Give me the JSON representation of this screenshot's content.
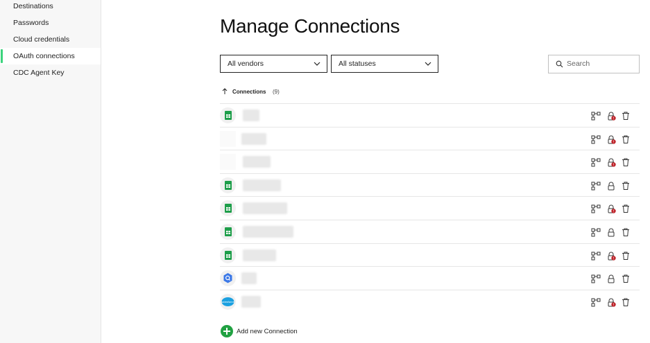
{
  "sidebar": {
    "items": [
      {
        "label": "Destinations",
        "active": false
      },
      {
        "label": "Passwords",
        "active": false
      },
      {
        "label": "Cloud credentials",
        "active": false
      },
      {
        "label": "OAuth connections",
        "active": true
      },
      {
        "label": "CDC Agent Key",
        "active": false
      }
    ]
  },
  "page": {
    "title": "Manage Connections"
  },
  "filters": {
    "vendor_label": "All vendors",
    "status_label": "All statuses",
    "search_placeholder": "Search"
  },
  "list": {
    "header_label": "Connections",
    "count_label": "(9)",
    "rows": [
      {
        "vendor_icon": "google-sheets-icon",
        "alert": true
      },
      {
        "vendor_icon": "unknown-vendor-icon",
        "alert": true
      },
      {
        "vendor_icon": "unknown-vendor-icon",
        "alert": true
      },
      {
        "vendor_icon": "google-sheets-icon",
        "alert": false
      },
      {
        "vendor_icon": "google-sheets-icon",
        "alert": true
      },
      {
        "vendor_icon": "google-sheets-icon",
        "alert": false
      },
      {
        "vendor_icon": "google-sheets-icon",
        "alert": true
      },
      {
        "vendor_icon": "google-cloud-icon",
        "alert": false
      },
      {
        "vendor_icon": "salesforce-icon",
        "alert": true
      }
    ]
  },
  "footer": {
    "add_label": "Add new Connection"
  },
  "colors": {
    "accent": "#3bd37c",
    "add_button": "#21a142",
    "alert_badge": "#c0262d",
    "sheets_green": "#1e9e4a"
  }
}
